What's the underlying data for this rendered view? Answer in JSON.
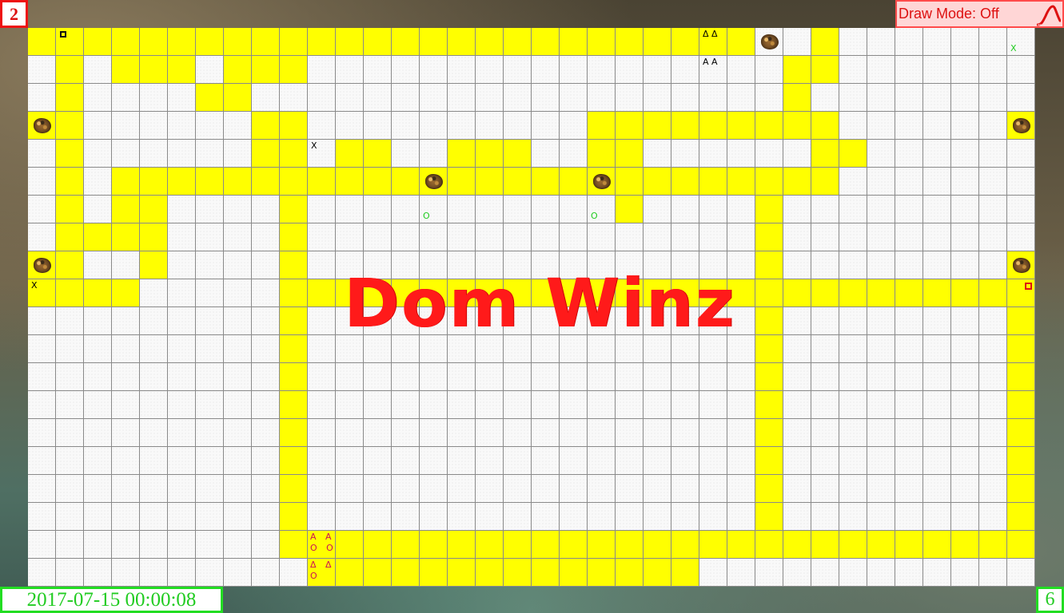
{
  "level": "2",
  "draw_mode": {
    "label": "Draw Mode: Off",
    "icon": "pen-curve-icon"
  },
  "timestamp": "2017-07-15 00:00:08",
  "counter": "6",
  "title": "Dom Winz",
  "colors": {
    "path": "#ffff00",
    "empty": "#f9f9f9",
    "accent_red": "#ff1a1a",
    "accent_green": "#22cc22"
  },
  "board": {
    "columns": 36,
    "rows": 20,
    "rows_map": [
      "YYYYYYYYYYYYYYYYYYYYYYYYYY..Y.......",
      ".Y.YYY.YYY.................YY.......",
      ".Y....YY...................Y........",
      "YY......YY..........YYYYYYYYY......Y",
      ".Y......YY.YY..YYY..YY......YY......",
      ".Y.YYYYYYYYYYYYYYYYYYYYYYYYYY.......",
      ".Y.YY....Y...........Y....Y.........",
      ".YYYY....Y................Y.........",
      "YY..Y....Y................Y........Y",
      "YYYY.....YYYYYYYYYYYYYYYYYYYYYYYYYYY",
      ".........Y................Y........Y",
      ".........Y................Y........Y",
      ".........Y................Y........Y",
      ".........Y................Y........Y",
      ".........Y................Y........Y",
      ".........Y................Y........Y",
      ".........Y................Y........Y",
      ".........Y................Y........Y",
      ".........YYYYYYYYYYYYYYYYYYYYYYYYYYY",
      "..........YYYYYYYYYYYYYY............"
    ],
    "rocks": [
      [
        0,
        26
      ],
      [
        3,
        0
      ],
      [
        3,
        35
      ],
      [
        5,
        14
      ],
      [
        5,
        20
      ],
      [
        8,
        0
      ],
      [
        8,
        35
      ]
    ],
    "markers": [
      {
        "r": 0,
        "c": 1,
        "kind": "square-black"
      },
      {
        "r": 0,
        "c": 24,
        "kind": "black",
        "text": "Δ Δ"
      },
      {
        "r": 1,
        "c": 24,
        "kind": "black",
        "text": "A A"
      },
      {
        "r": 0,
        "c": 35,
        "kind": "green",
        "text": "X"
      },
      {
        "r": 4,
        "c": 10,
        "kind": "black",
        "text": "X"
      },
      {
        "r": 6,
        "c": 14,
        "kind": "green",
        "text": "O"
      },
      {
        "r": 6,
        "c": 20,
        "kind": "green",
        "text": "O"
      },
      {
        "r": 9,
        "c": 0,
        "kind": "black",
        "text": "X"
      },
      {
        "r": 9,
        "c": 35,
        "kind": "square-red"
      },
      {
        "r": 18,
        "c": 10,
        "kind": "red-pair",
        "text": "A A\nO O"
      },
      {
        "r": 19,
        "c": 10,
        "kind": "red-pair",
        "text": "Δ Δ\nO"
      }
    ]
  }
}
